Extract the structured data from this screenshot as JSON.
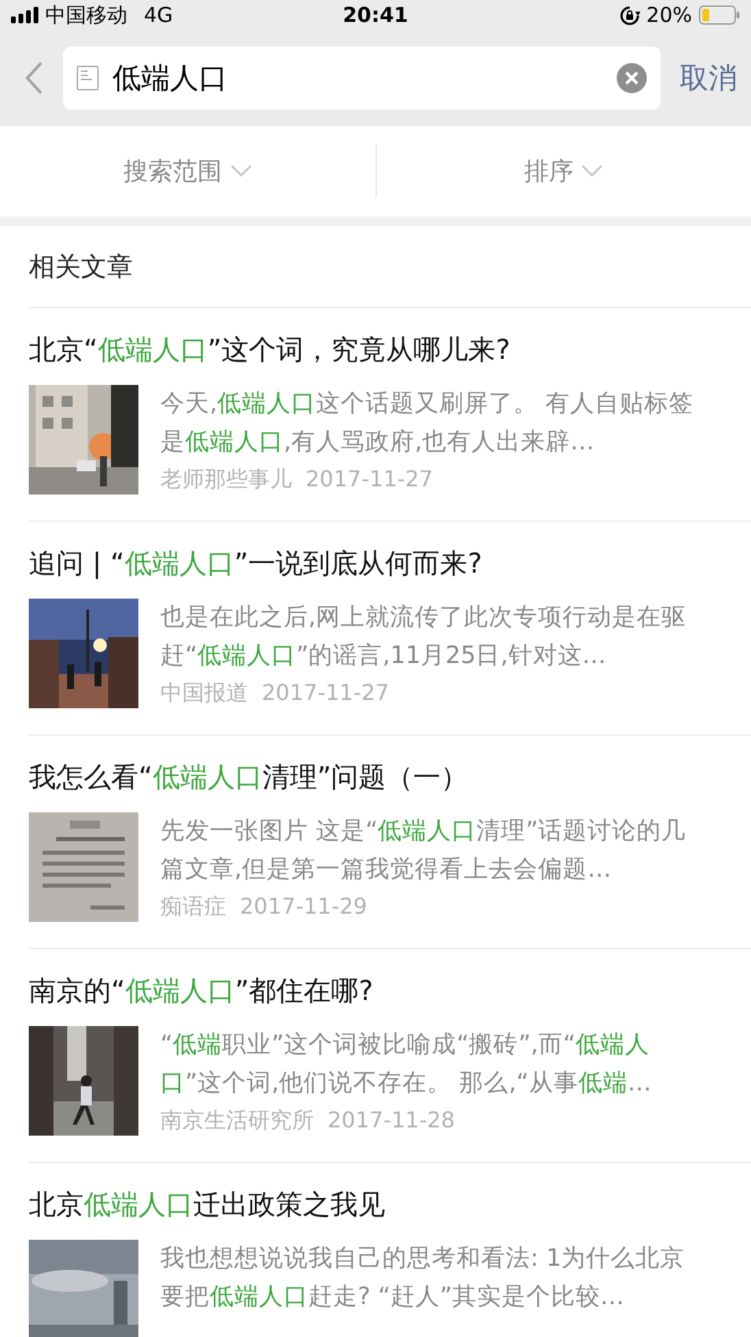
{
  "status_bar": {
    "carrier": "中国移动",
    "network": "4G",
    "time": "20:41",
    "battery": "20%"
  },
  "search": {
    "value": "低端人口",
    "cancel": "取消"
  },
  "filters": [
    {
      "label": "搜索范围"
    },
    {
      "label": "排序"
    }
  ],
  "section_title": "相关文章",
  "articles": [
    {
      "title": "北京“**低端人口**”这个词，究竟从哪儿来?",
      "snippet": "今天,**低端人口**这个话题又刷屏了。 有人自贴标签是**低端人口**,有人骂政府,也有人出来辟…",
      "source": "老师那些事儿",
      "date": "2017-11-27"
    },
    {
      "title": "追问 | “**低端人口**”一说到底从何而来?",
      "snippet": "也是在此之后,网上就流传了此次专项行动是在驱赶“**低端人口**”的谣言,11月25日,针对这…",
      "source": "中国报道",
      "date": "2017-11-27"
    },
    {
      "title": "我怎么看“**低端人口**清理”问题（一）",
      "snippet": "先发一张图片 这是“**低端人口**清理”话题讨论的几篇文章,但是第一篇我觉得看上去会偏题…",
      "source": "痴语症",
      "date": "2017-11-29"
    },
    {
      "title": "南京的“**低端人口**”都住在哪?",
      "snippet": "“**低端**职业”这个词被比喻成“搬砖”,而“**低端人口**”这个词,他们说不存在。 那么,“从事**低端**…",
      "source": "南京生活研究所",
      "date": "2017-11-28"
    },
    {
      "title": "北京**低端人口**迁出政策之我见",
      "snippet": "我也想想说说我自己的思考和看法: 1为什么北京要把**低端人口**赶走? “赶人”其实是个比较…"
    }
  ]
}
